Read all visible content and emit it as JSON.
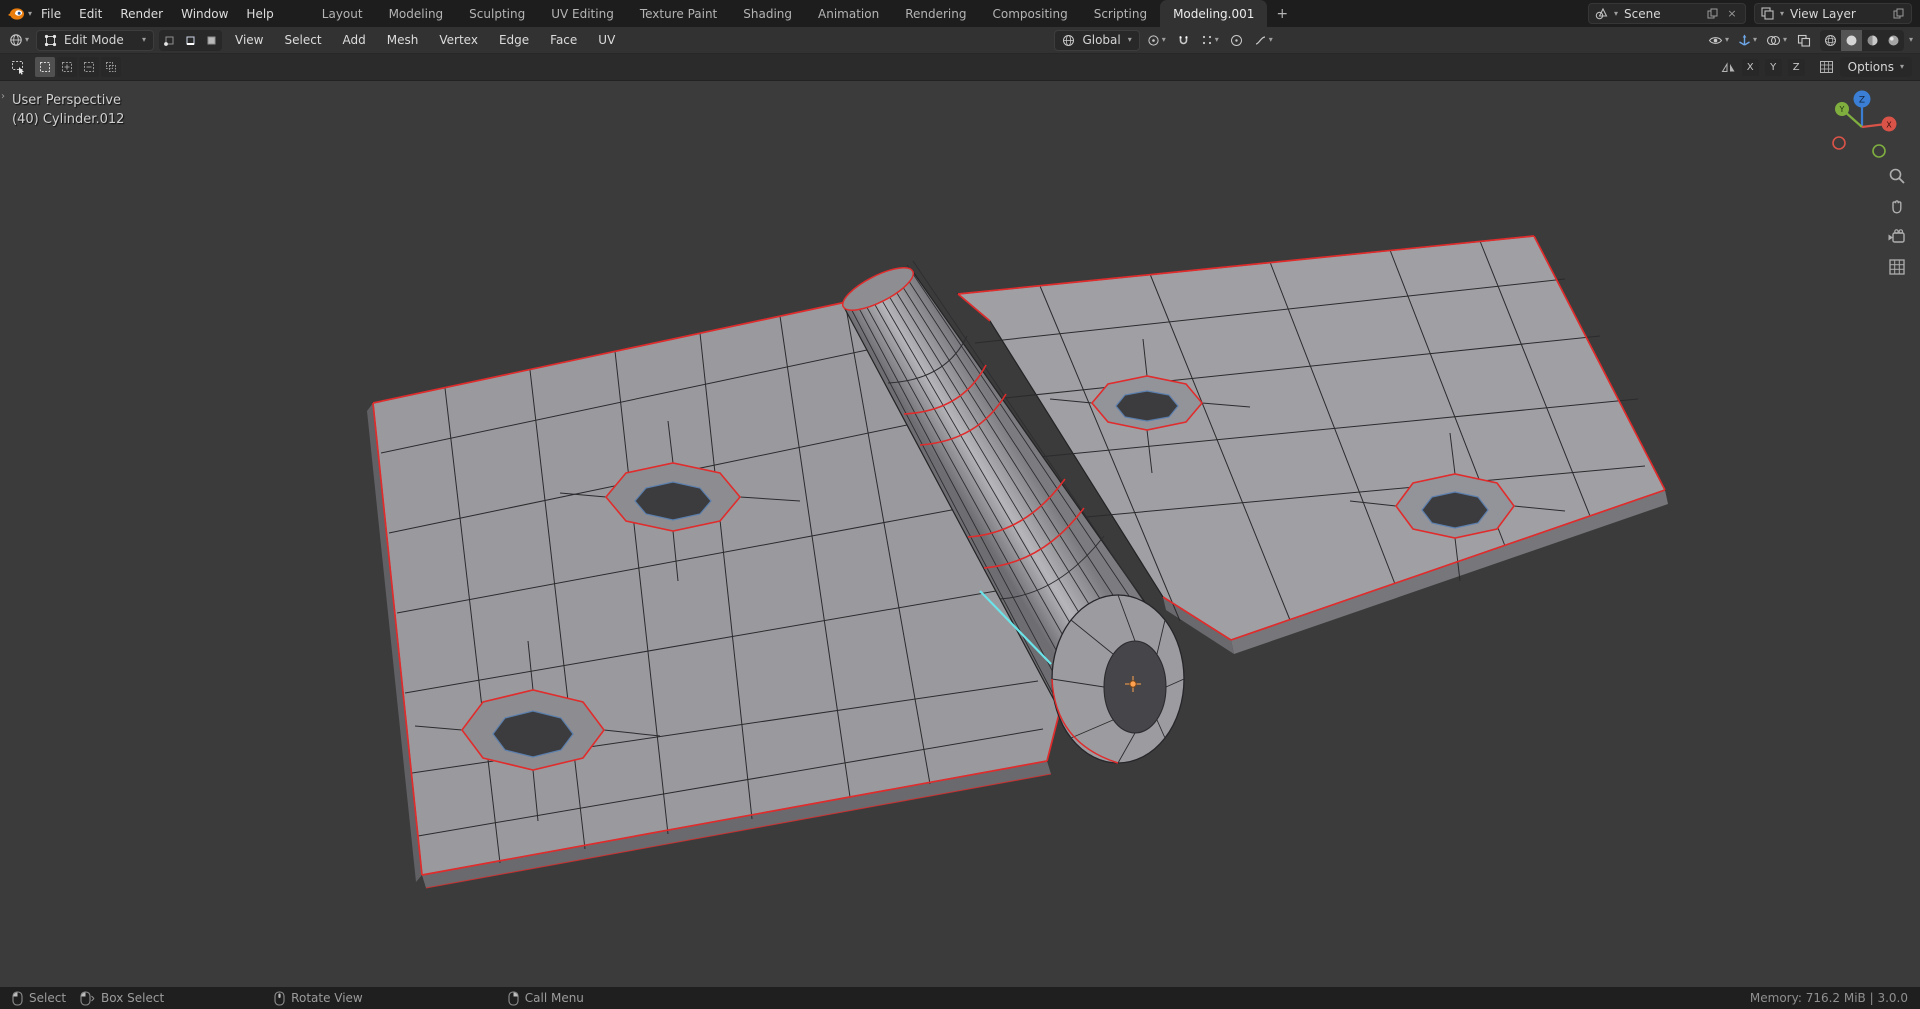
{
  "icons": {
    "chevron": "▾",
    "close": "×",
    "add": "+"
  },
  "topbar": {
    "menus": [
      "File",
      "Edit",
      "Render",
      "Window",
      "Help"
    ],
    "tabs": [
      "Layout",
      "Modeling",
      "Sculpting",
      "UV Editing",
      "Texture Paint",
      "Shading",
      "Animation",
      "Rendering",
      "Compositing",
      "Scripting",
      "Modeling.001"
    ],
    "active_tab": "Modeling.001",
    "add_tab": "+",
    "scene_label": "Scene",
    "view_layer_label": "View Layer"
  },
  "header": {
    "mode": "Edit Mode",
    "menus": [
      "View",
      "Select",
      "Add",
      "Mesh",
      "Vertex",
      "Edge",
      "Face",
      "UV"
    ],
    "orientation": "Global",
    "options_label": "Options"
  },
  "tool_settings": {
    "mirror_axes": [
      "X",
      "Y",
      "Z"
    ]
  },
  "viewport": {
    "view_label": "User Perspective",
    "object_label": "(40) Cylinder.012",
    "gizmo": {
      "x": "X",
      "y": "Y",
      "z": "Z"
    }
  },
  "statusbar": {
    "hints": [
      {
        "icon": "mouse-left",
        "label": "Select"
      },
      {
        "icon": "mouse-left-drag",
        "label": "Box Select"
      },
      {
        "icon": "mouse-middle",
        "label": "Rotate View"
      },
      {
        "icon": "mouse-right",
        "label": "Call Menu"
      }
    ],
    "memory": "Memory: 716.2 MiB | 3.0.0"
  },
  "colors": {
    "accent_blue": "#4772b3",
    "seam_red": "#e02c2c",
    "edge_highlight_cyan": "#6ce3e8",
    "origin_orange": "#ffa14f",
    "axis_x": "#d95348",
    "axis_y": "#7fae3f",
    "axis_z": "#3a7fd5",
    "viewport_bg": "#3b3b3b",
    "mesh_gray": "#9a9a9e"
  }
}
